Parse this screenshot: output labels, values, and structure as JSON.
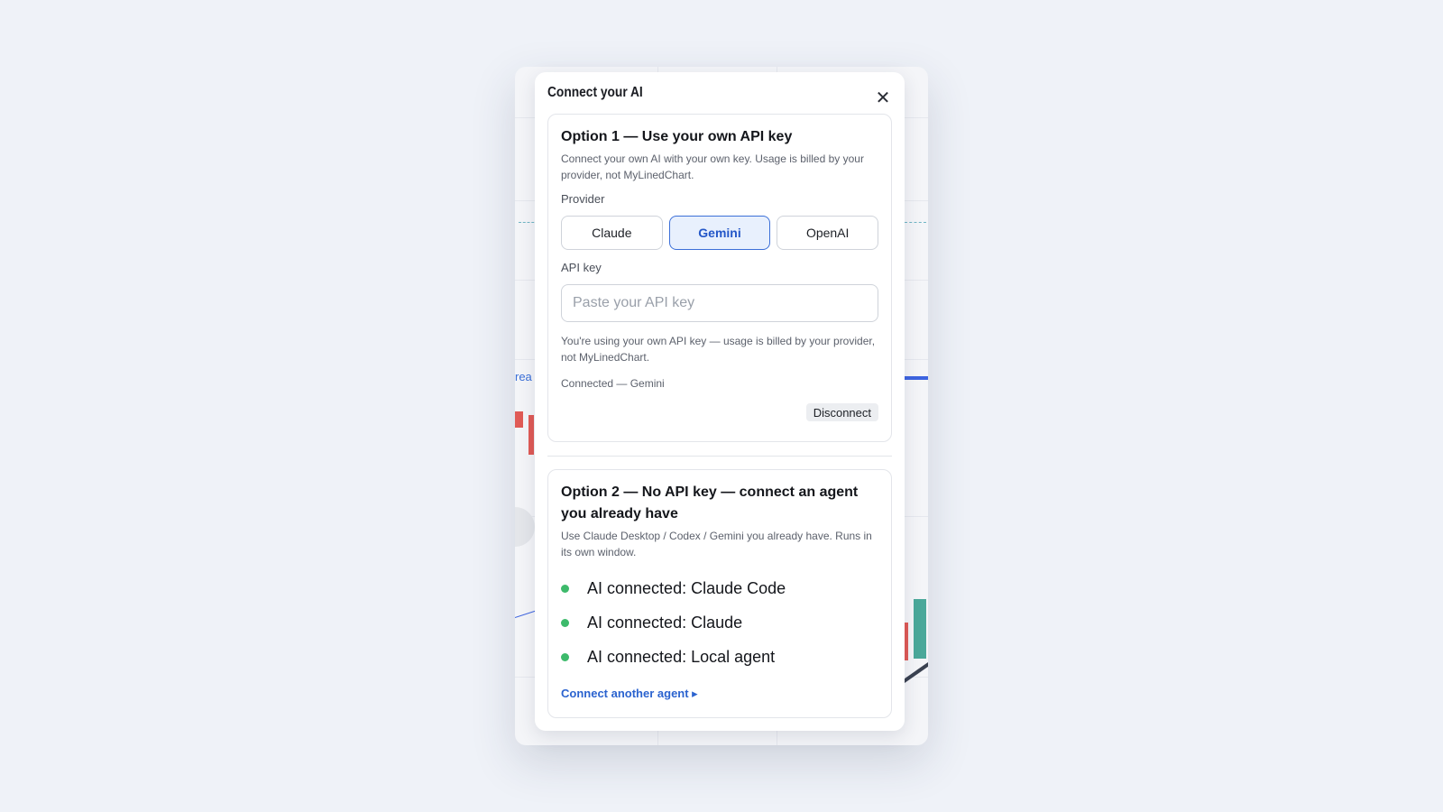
{
  "modal": {
    "title": "Connect your AI",
    "close_symbol": "✕"
  },
  "option1": {
    "title": "Option 1 — Use your own API key",
    "description": "Connect your own AI with your own key. Usage is billed by your provider, not MyLinedChart.",
    "provider_label": "Provider",
    "providers": [
      {
        "label": "Claude",
        "selected": false
      },
      {
        "label": "Gemini",
        "selected": true
      },
      {
        "label": "OpenAI",
        "selected": false
      }
    ],
    "api_key_label": "API key",
    "api_key_placeholder": "Paste your API key",
    "api_key_value": "",
    "billing_note": "You're using your own API key — usage is billed by your provider, not MyLinedChart.",
    "status": "Connected — Gemini",
    "disconnect_label": "Disconnect"
  },
  "option2": {
    "title": "Option 2 — No API key — connect an agent you already have",
    "description": "Use Claude Desktop / Codex / Gemini you already have. Runs in its own window.",
    "agents": [
      {
        "label": "AI connected: Claude Code",
        "status_color": "#3dba6b"
      },
      {
        "label": "AI connected: Claude",
        "status_color": "#3dba6b"
      },
      {
        "label": "AI connected: Local agent",
        "status_color": "#3dba6b"
      }
    ],
    "connect_link": "Connect another agent ▸"
  },
  "background": {
    "fragment_text": "rea"
  },
  "colors": {
    "accent": "#3b6fd8",
    "active_bg": "#e8f0fd",
    "connected": "#3dba6b",
    "link": "#2b63cf"
  }
}
